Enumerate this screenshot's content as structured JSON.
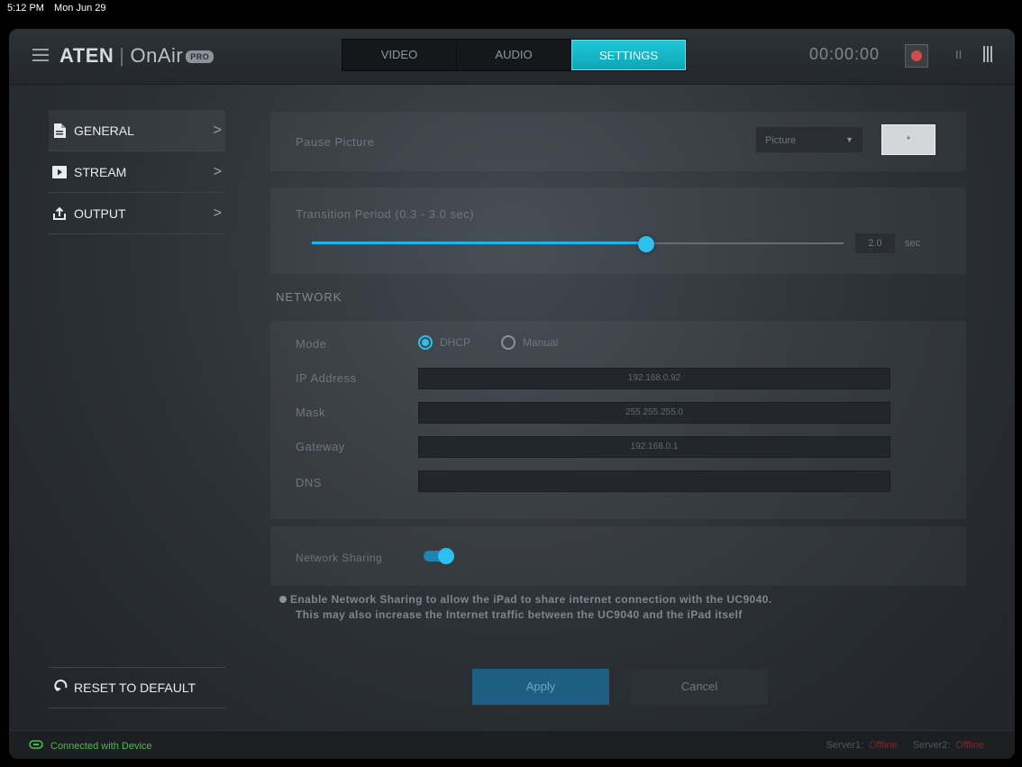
{
  "status_bar": {
    "time": "5:12 PM",
    "date": "Mon Jun 29"
  },
  "header": {
    "brand": "ATEN",
    "product": "OnAir",
    "badge": "PRO",
    "tabs": [
      {
        "label": "VIDEO",
        "active": false
      },
      {
        "label": "AUDIO",
        "active": false
      },
      {
        "label": "SETTINGS",
        "active": true
      }
    ],
    "timer": "00:00:00",
    "pause_glyph": "II"
  },
  "sidebar": {
    "items": [
      {
        "label": "GENERAL",
        "icon": "document-icon",
        "active": true
      },
      {
        "label": "STREAM",
        "icon": "play-icon",
        "active": false
      },
      {
        "label": "OUTPUT",
        "icon": "upload-icon",
        "active": false
      }
    ],
    "chevron": ">",
    "reset_label": "RESET TO DEFAULT"
  },
  "general": {
    "pause_picture": {
      "label": "Pause Picture",
      "select_value": "Picture",
      "select_arrow": "▼"
    },
    "transition": {
      "label": "Transition Period (0.3 - 3.0 sec)",
      "value": "2.0",
      "unit": "sec",
      "min": 0.3,
      "max": 3.0,
      "current": 2.0
    }
  },
  "network": {
    "title": "NETWORK",
    "mode_label": "Mode",
    "mode_options": [
      {
        "label": "DHCP",
        "selected": true
      },
      {
        "label": "Manual",
        "selected": false
      }
    ],
    "fields": [
      {
        "label": "IP Address",
        "value": "192.168.0.92"
      },
      {
        "label": "Mask",
        "value": "255.255.255.0"
      },
      {
        "label": "Gateway",
        "value": "192.168.0.1"
      },
      {
        "label": "DNS",
        "value": ""
      }
    ],
    "sharing_label": "Network Sharing",
    "sharing_enabled": true,
    "note_line1": "Enable Network Sharing to allow the iPad to share internet connection with the UC9040.",
    "note_line2": "This may also increase the Internet traffic between the UC9040 and the iPad itself"
  },
  "actions": {
    "apply": "Apply",
    "cancel": "Cancel"
  },
  "footer": {
    "connection": "Connected with Device",
    "server1_label": "Server1:",
    "server1_status": "Offline",
    "server2_label": "Server2:",
    "server2_status": "Offline"
  },
  "colors": {
    "accent": "#1ec7d6",
    "slider": "#2bc0ef",
    "connected": "#3fc33f",
    "record": "#d24b4b"
  }
}
